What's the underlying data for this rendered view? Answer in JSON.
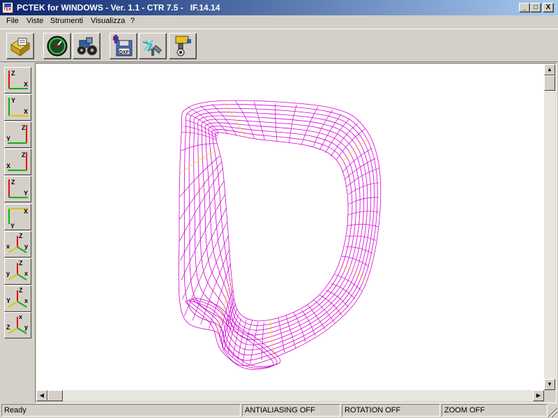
{
  "window": {
    "title": "PCTEK for WINDOWS - Ver. 1.1 - CTR 7.5 -   IF.14.14",
    "icon_text": "TEK",
    "minimize": "_",
    "maximize": "□",
    "close": "X"
  },
  "menu": {
    "items": [
      "File",
      "Viste",
      "Strumenti",
      "Visualizza",
      "?"
    ]
  },
  "toolbar": {
    "buttons": [
      {
        "icon": "open-file-icon"
      },
      {
        "icon": "speedometer-icon"
      },
      {
        "icon": "tractor-icon"
      },
      {
        "icon": "dxf-save-icon"
      },
      {
        "icon": "cnc-tool-icon"
      },
      {
        "icon": "milling-machine-icon"
      }
    ]
  },
  "views": [
    {
      "name": "view-xz",
      "top": "Z",
      "right": "X"
    },
    {
      "name": "view-xy",
      "top": "Y",
      "right": "X"
    },
    {
      "name": "view-yz-left",
      "top": "Z",
      "left": "Y"
    },
    {
      "name": "view-xz-left",
      "top": "Z",
      "left": "X"
    },
    {
      "name": "view-zy",
      "top": "Z",
      "right": "Y"
    },
    {
      "name": "view-yx-down",
      "bottom": "Y",
      "right": "X"
    },
    {
      "name": "view-iso-1",
      "labels": [
        "Z",
        "x",
        "y"
      ]
    },
    {
      "name": "view-iso-2",
      "labels": [
        "Z",
        "y",
        "x"
      ]
    },
    {
      "name": "view-iso-3",
      "labels": [
        "Z",
        "Y",
        "x"
      ]
    },
    {
      "name": "view-iso-4",
      "labels": [
        "x",
        "Z",
        "y"
      ]
    }
  ],
  "status": {
    "ready": "Ready",
    "antialiasing": "ANTIALIASING OFF",
    "rotation": "ROTATION OFF",
    "zoom": "ZOOM OFF"
  },
  "colors": {
    "wireframe": "#d000d0",
    "wireframe_accent": "#ffd800",
    "axis_red": "#e01010",
    "axis_green": "#10b010",
    "axis_yellow": "#d8c800"
  }
}
